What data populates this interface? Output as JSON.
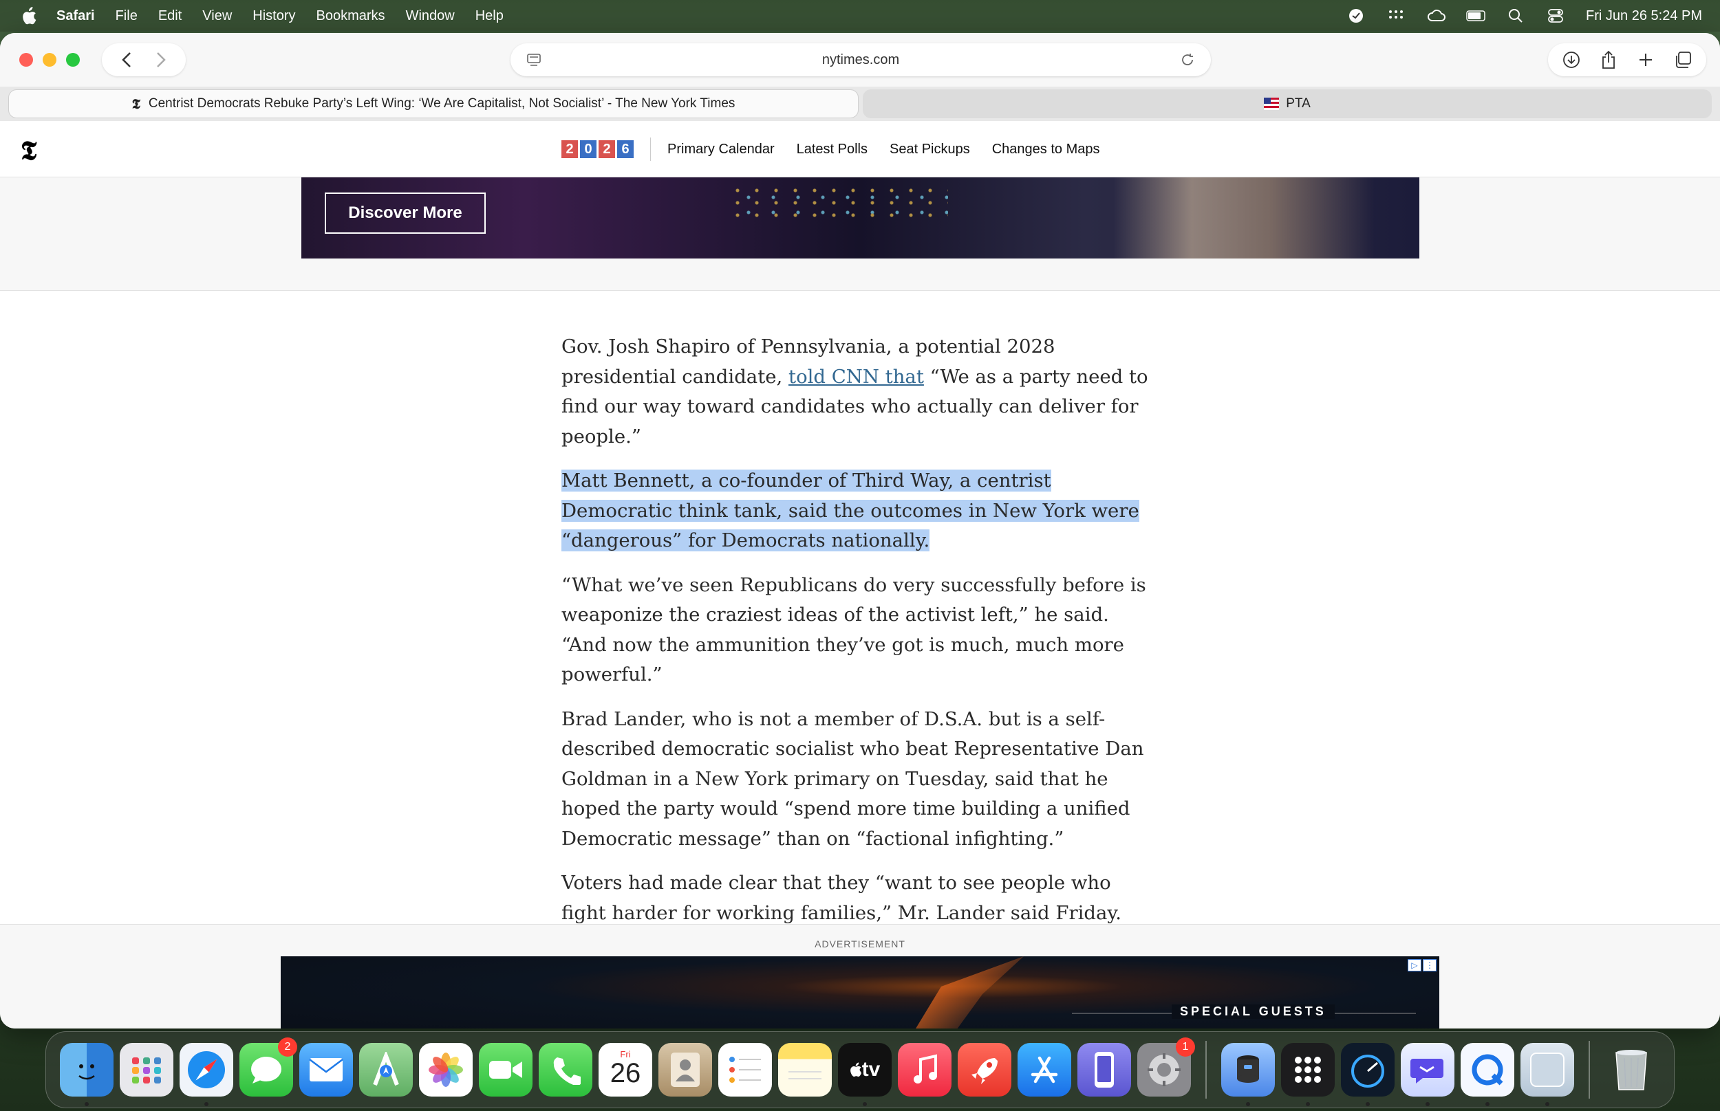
{
  "menubar": {
    "app": "Safari",
    "items": [
      "File",
      "Edit",
      "View",
      "History",
      "Bookmarks",
      "Window",
      "Help"
    ],
    "clock": "Fri Jun 26  5:24 PM"
  },
  "browser": {
    "url": "nytimes.com",
    "tabs": [
      {
        "title": "Centrist Democrats Rebuke Party’s Left Wing: ‘We Are Capitalist, Not Socialist’ - The New York Times",
        "active": true
      },
      {
        "title": "PTA",
        "active": false
      }
    ]
  },
  "nyt": {
    "logo": "𝕿",
    "year_digits": [
      "2",
      "0",
      "2",
      "6"
    ],
    "nav": [
      "Primary Calendar",
      "Latest Polls",
      "Seat Pickups",
      "Changes to Maps"
    ]
  },
  "top_ad": {
    "button": "Discover More"
  },
  "article": {
    "p1_before": "Gov. Josh Shapiro of Pennsylvania, a potential 2028 presidential candidate, ",
    "p1_link": "told CNN that",
    "p1_after": " “We as a party need to find our way toward candidates who actually can deliver for people.”",
    "p2": "Matt Bennett, a co-founder of Third Way, a centrist Democratic think tank, said the outcomes in New York were “dangerous” for Democrats nationally.",
    "p3": "“What we’ve seen Republicans do very successfully before is weaponize the craziest ideas of the activist left,” he said. “And now the ammunition they’ve got is much, much more powerful.”",
    "p4": "Brad Lander, who is not a member of D.S.A. but is a self-described democratic socialist who beat Representative Dan Goldman in a New York primary on Tuesday, said that he hoped the party would “spend more time building a unified Democratic message” than on “factional infighting.”",
    "p5": "Voters had made clear that they “want to see people who fight harder for working families,” Mr. Lander said Friday."
  },
  "bottom_ad": {
    "label": "ADVERTISEMENT",
    "text": "SPECIAL GUESTS"
  },
  "dock": {
    "calendar_day": "Fri",
    "calendar_date": "26",
    "messages_badge": "2",
    "settings_badge": "1",
    "tv_label": "tv"
  }
}
